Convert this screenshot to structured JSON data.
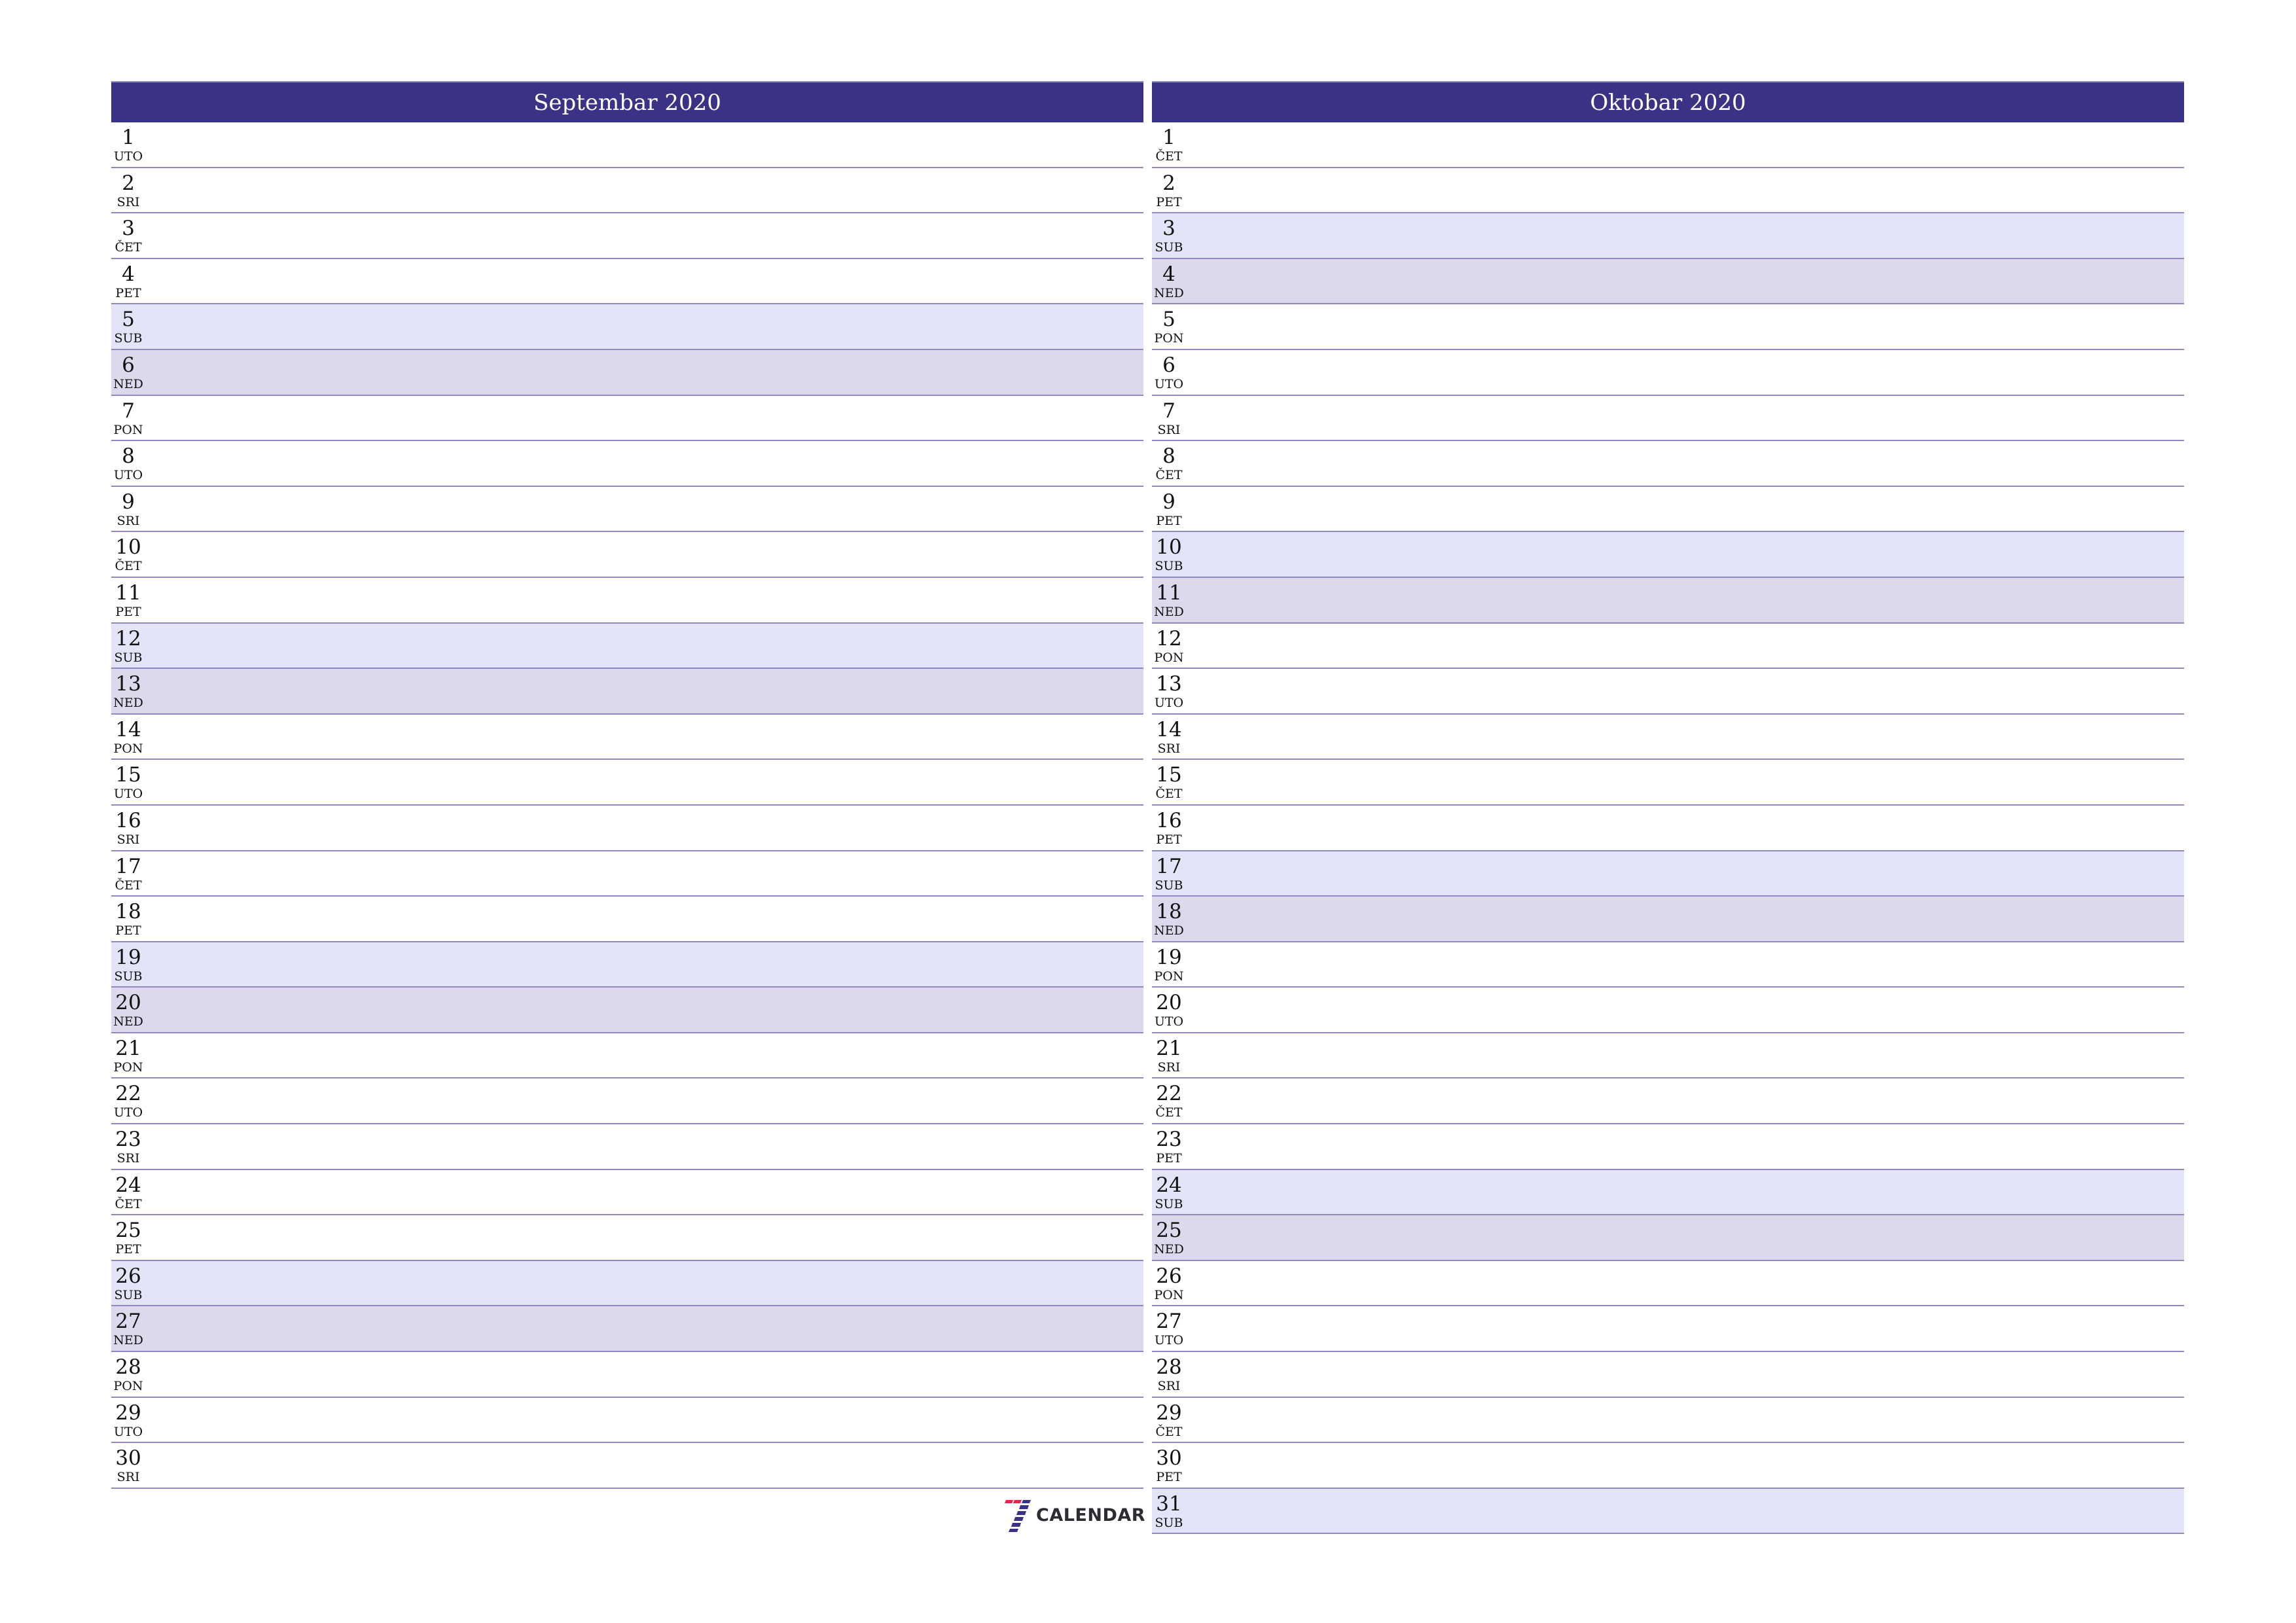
{
  "colors": {
    "header_bg": "#3a3284",
    "saturday_bg": "#e3e4f7",
    "sunday_bg": "#ddd8ec",
    "row_line": "#8e89c0",
    "logo_red": "#e8224a",
    "logo_navy": "#3a3284",
    "logo_text": "#2e2b33"
  },
  "months": [
    {
      "title": "Septembar 2020",
      "days": [
        {
          "num": "1",
          "wd": "UTO",
          "type": "weekday"
        },
        {
          "num": "2",
          "wd": "SRI",
          "type": "weekday"
        },
        {
          "num": "3",
          "wd": "ČET",
          "type": "weekday"
        },
        {
          "num": "4",
          "wd": "PET",
          "type": "weekday"
        },
        {
          "num": "5",
          "wd": "SUB",
          "type": "sat"
        },
        {
          "num": "6",
          "wd": "NED",
          "type": "sun"
        },
        {
          "num": "7",
          "wd": "PON",
          "type": "weekday"
        },
        {
          "num": "8",
          "wd": "UTO",
          "type": "weekday"
        },
        {
          "num": "9",
          "wd": "SRI",
          "type": "weekday"
        },
        {
          "num": "10",
          "wd": "ČET",
          "type": "weekday"
        },
        {
          "num": "11",
          "wd": "PET",
          "type": "weekday"
        },
        {
          "num": "12",
          "wd": "SUB",
          "type": "sat"
        },
        {
          "num": "13",
          "wd": "NED",
          "type": "sun"
        },
        {
          "num": "14",
          "wd": "PON",
          "type": "weekday"
        },
        {
          "num": "15",
          "wd": "UTO",
          "type": "weekday"
        },
        {
          "num": "16",
          "wd": "SRI",
          "type": "weekday"
        },
        {
          "num": "17",
          "wd": "ČET",
          "type": "weekday"
        },
        {
          "num": "18",
          "wd": "PET",
          "type": "weekday"
        },
        {
          "num": "19",
          "wd": "SUB",
          "type": "sat"
        },
        {
          "num": "20",
          "wd": "NED",
          "type": "sun"
        },
        {
          "num": "21",
          "wd": "PON",
          "type": "weekday"
        },
        {
          "num": "22",
          "wd": "UTO",
          "type": "weekday"
        },
        {
          "num": "23",
          "wd": "SRI",
          "type": "weekday"
        },
        {
          "num": "24",
          "wd": "ČET",
          "type": "weekday"
        },
        {
          "num": "25",
          "wd": "PET",
          "type": "weekday"
        },
        {
          "num": "26",
          "wd": "SUB",
          "type": "sat"
        },
        {
          "num": "27",
          "wd": "NED",
          "type": "sun"
        },
        {
          "num": "28",
          "wd": "PON",
          "type": "weekday"
        },
        {
          "num": "29",
          "wd": "UTO",
          "type": "weekday"
        },
        {
          "num": "30",
          "wd": "SRI",
          "type": "weekday"
        }
      ]
    },
    {
      "title": "Oktobar 2020",
      "days": [
        {
          "num": "1",
          "wd": "ČET",
          "type": "weekday"
        },
        {
          "num": "2",
          "wd": "PET",
          "type": "weekday"
        },
        {
          "num": "3",
          "wd": "SUB",
          "type": "sat"
        },
        {
          "num": "4",
          "wd": "NED",
          "type": "sun"
        },
        {
          "num": "5",
          "wd": "PON",
          "type": "weekday"
        },
        {
          "num": "6",
          "wd": "UTO",
          "type": "weekday"
        },
        {
          "num": "7",
          "wd": "SRI",
          "type": "weekday"
        },
        {
          "num": "8",
          "wd": "ČET",
          "type": "weekday"
        },
        {
          "num": "9",
          "wd": "PET",
          "type": "weekday"
        },
        {
          "num": "10",
          "wd": "SUB",
          "type": "sat"
        },
        {
          "num": "11",
          "wd": "NED",
          "type": "sun"
        },
        {
          "num": "12",
          "wd": "PON",
          "type": "weekday"
        },
        {
          "num": "13",
          "wd": "UTO",
          "type": "weekday"
        },
        {
          "num": "14",
          "wd": "SRI",
          "type": "weekday"
        },
        {
          "num": "15",
          "wd": "ČET",
          "type": "weekday"
        },
        {
          "num": "16",
          "wd": "PET",
          "type": "weekday"
        },
        {
          "num": "17",
          "wd": "SUB",
          "type": "sat"
        },
        {
          "num": "18",
          "wd": "NED",
          "type": "sun"
        },
        {
          "num": "19",
          "wd": "PON",
          "type": "weekday"
        },
        {
          "num": "20",
          "wd": "UTO",
          "type": "weekday"
        },
        {
          "num": "21",
          "wd": "SRI",
          "type": "weekday"
        },
        {
          "num": "22",
          "wd": "ČET",
          "type": "weekday"
        },
        {
          "num": "23",
          "wd": "PET",
          "type": "weekday"
        },
        {
          "num": "24",
          "wd": "SUB",
          "type": "sat"
        },
        {
          "num": "25",
          "wd": "NED",
          "type": "sun"
        },
        {
          "num": "26",
          "wd": "PON",
          "type": "weekday"
        },
        {
          "num": "27",
          "wd": "UTO",
          "type": "weekday"
        },
        {
          "num": "28",
          "wd": "SRI",
          "type": "weekday"
        },
        {
          "num": "29",
          "wd": "ČET",
          "type": "weekday"
        },
        {
          "num": "30",
          "wd": "PET",
          "type": "weekday"
        },
        {
          "num": "31",
          "wd": "SUB",
          "type": "sat"
        }
      ]
    }
  ],
  "logo": {
    "icon": "seven-stripes-logo-icon",
    "text": "CALENDAR"
  }
}
